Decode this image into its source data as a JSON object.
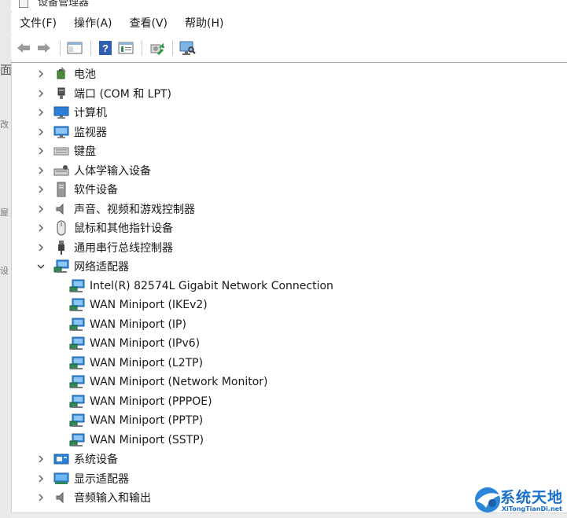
{
  "window": {
    "title": "设备管理器"
  },
  "menu": [
    "文件(F)",
    "操作(A)",
    "查看(V)",
    "帮助(H)"
  ],
  "toolbar": {
    "buttons": [
      "back-icon",
      "forward-icon",
      "show-hide-console-tree-icon",
      "help-icon",
      "properties-icon",
      "update-driver-icon",
      "scan-hardware-icon"
    ]
  },
  "left_strip": {
    "fragments": [
      "面",
      "改",
      "屋",
      "设"
    ]
  },
  "tree": {
    "categories": [
      {
        "label": "电池",
        "icon": "battery-icon",
        "expanded": false
      },
      {
        "label": "端口 (COM 和 LPT)",
        "icon": "port-icon",
        "expanded": false
      },
      {
        "label": "计算机",
        "icon": "computer-icon",
        "expanded": false
      },
      {
        "label": "监视器",
        "icon": "monitor-icon",
        "expanded": false
      },
      {
        "label": "键盘",
        "icon": "keyboard-icon",
        "expanded": false
      },
      {
        "label": "人体学输入设备",
        "icon": "hid-icon",
        "expanded": false
      },
      {
        "label": "软件设备",
        "icon": "software-device-icon",
        "expanded": false
      },
      {
        "label": "声音、视频和游戏控制器",
        "icon": "audio-icon",
        "expanded": false
      },
      {
        "label": "鼠标和其他指针设备",
        "icon": "mouse-icon",
        "expanded": false
      },
      {
        "label": "通用串行总线控制器",
        "icon": "usb-icon",
        "expanded": false
      },
      {
        "label": "网络适配器",
        "icon": "network-icon",
        "expanded": true
      }
    ],
    "network_children": [
      "Intel(R) 82574L Gigabit Network Connection",
      "WAN Miniport (IKEv2)",
      "WAN Miniport (IP)",
      "WAN Miniport (IPv6)",
      "WAN Miniport (L2TP)",
      "WAN Miniport (Network Monitor)",
      "WAN Miniport (PPPOE)",
      "WAN Miniport (PPTP)",
      "WAN Miniport (SSTP)"
    ],
    "trailing_categories": [
      {
        "label": "系统设备",
        "icon": "system-device-icon",
        "expanded": false
      },
      {
        "label": "显示适配器",
        "icon": "display-adapter-icon",
        "expanded": false
      },
      {
        "label": "音频输入和输出",
        "icon": "audio-io-icon",
        "expanded": false
      }
    ]
  },
  "watermark": {
    "title": "系统天地",
    "subtitle": "XiTongTianDi.net"
  },
  "colors": {
    "accent": "#1a6fc9",
    "selection": "#cce8ff"
  }
}
